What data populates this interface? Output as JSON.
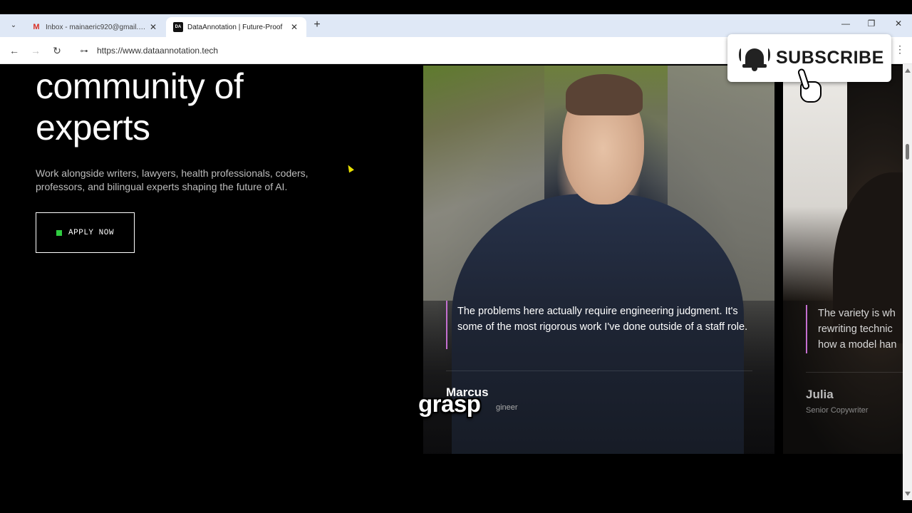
{
  "browser": {
    "tabs": [
      {
        "title": "Inbox - mainaeric920@gmail.com",
        "icon": "gmail-icon",
        "active": false
      },
      {
        "title": "DataAnnotation | Future-Proof",
        "icon": "da-favicon-icon",
        "favicon_text": "DA",
        "active": true
      }
    ],
    "tab_close": "✕",
    "new_tab": "+",
    "url": "https://www.dataannotation.tech",
    "controls": {
      "back": "←",
      "forward": "→",
      "reload": "↻",
      "minimize": "—",
      "restore": "❐",
      "close": "✕",
      "menu": "⋮",
      "tab_menu": "⌄",
      "site_info": "⊶"
    }
  },
  "hero": {
    "headline_line1": "community of",
    "headline_line2": "experts",
    "subtext": "Work alongside writers, lawyers, health professionals, coders, professors, and bilingual experts shaping the future of AI.",
    "apply_label": "APPLY NOW",
    "apply_dot_color": "#2ecc40"
  },
  "testimonials": [
    {
      "quote": "The problems here actually require engineering judgment. It's some of the most rigorous work I've done outside of a staff role.",
      "name": "Marcus",
      "role_visible": "gineer",
      "accent": "#c46fd0"
    },
    {
      "quote_lines": [
        "The variety is wh",
        "rewriting technic",
        "how a model han"
      ],
      "name": "Julia",
      "role": "Senior Copywriter",
      "accent": "#c46fd0"
    }
  ],
  "overlay": {
    "caption_word": "grasp",
    "subscribe_label": "SUBSCRIBE"
  }
}
